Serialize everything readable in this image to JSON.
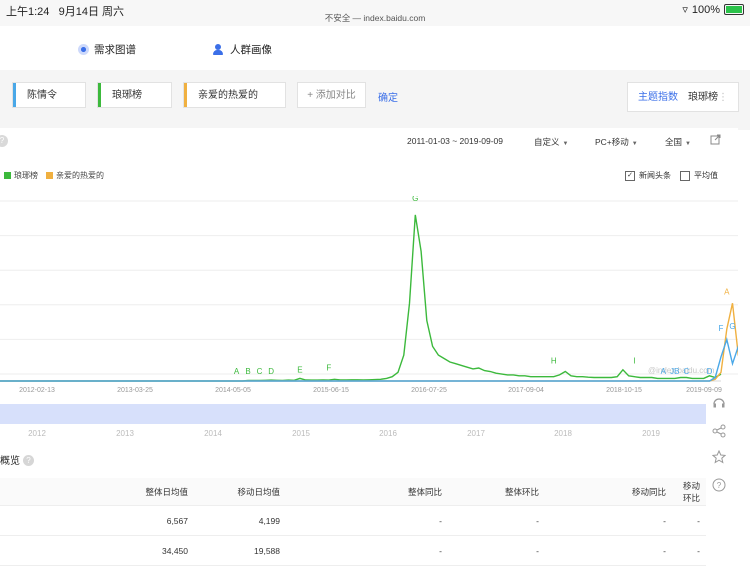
{
  "statusbar": {
    "time": "上午1:24",
    "date": "9月14日 周六",
    "url": "不安全 — index.baidu.com",
    "battery": "100%"
  },
  "subnav": {
    "tab1": "需求图谱",
    "tab2": "人群画像"
  },
  "keywords": {
    "items": [
      {
        "label": "陈情令",
        "color": "#4aa8e8"
      },
      {
        "label": "琅琊榜",
        "color": "#3cb93c"
      },
      {
        "label": "亲爱的热爱的",
        "color": "#f0b040"
      }
    ],
    "add_label": "+ 添加对比",
    "confirm_label": "确定",
    "theme_label": "主题指数",
    "theme_keyword": "琅琊榜"
  },
  "controls": {
    "date_range": "2011-01-03 ~ 2019-09-09",
    "custom": "自定义",
    "device": "PC+移动",
    "region": "全国"
  },
  "options": {
    "news": "新闻头条",
    "average": "平均值"
  },
  "chart_data": {
    "type": "line",
    "legend": [
      "琅琊榜",
      "亲爱的热爱的"
    ],
    "x_ticks": [
      "2012-02-13",
      "2013-03-25",
      "2014-05-05",
      "2015-06-15",
      "2016-07-25",
      "2017-09-04",
      "2018-10-15",
      "2019-09-09"
    ],
    "year_ticks": [
      "2012",
      "2013",
      "2014",
      "2015",
      "2016",
      "2017",
      "2018",
      "2019"
    ],
    "watermark": "@index.baidu.com",
    "series": [
      {
        "name": "琅琊榜",
        "color": "#3cb93c",
        "values": [
          0,
          0,
          0,
          0,
          0,
          0,
          0,
          0,
          0,
          0,
          0,
          0,
          0,
          0,
          0,
          0,
          0,
          0,
          0,
          0,
          0,
          0,
          0,
          0,
          0,
          0,
          0,
          0,
          0,
          0,
          0,
          0,
          0,
          0,
          0,
          0,
          0,
          0,
          0,
          0,
          0,
          0,
          0,
          0.3,
          0.3,
          0.3,
          0.4,
          0.5,
          0.4,
          0.3,
          0.5,
          0.4,
          1.5,
          0.6,
          0.5,
          0.5,
          0.6,
          0.5,
          1.0,
          0.6,
          0.6,
          0.7,
          0.7,
          0.6,
          0.7,
          0.8,
          1.0,
          1.5,
          2.5,
          5,
          15,
          45,
          96,
          75,
          35,
          20,
          15,
          13,
          11,
          10,
          9,
          8,
          7,
          7.5,
          6,
          5.5,
          4.5,
          4,
          3.5,
          3.5,
          3,
          3,
          2.5,
          2.5,
          2.5,
          2.5,
          2.5,
          3.5,
          5.5,
          3,
          2.5,
          2.5,
          2.2,
          2,
          2,
          2,
          2,
          2.5,
          6.5,
          3,
          2.5,
          2,
          2,
          2,
          1.5,
          1.5,
          1.5,
          1.5,
          2,
          2,
          1.5,
          1.5,
          1.5,
          3,
          2,
          4
        ]
      },
      {
        "name": "亲爱的热爱的",
        "color": "#f0b040",
        "values": [
          0,
          0,
          0,
          0,
          0,
          0,
          0,
          0,
          0,
          0,
          0,
          0,
          0,
          0,
          0,
          0,
          0,
          0,
          0,
          0,
          0,
          0,
          0,
          0,
          0,
          0,
          0,
          0,
          0,
          0,
          0,
          0,
          0,
          0,
          0,
          0,
          0,
          0,
          0,
          0,
          0,
          0,
          0,
          0,
          0,
          0,
          0,
          0,
          0,
          0,
          0,
          0,
          0,
          0,
          0,
          0,
          0,
          0,
          0,
          0,
          0,
          0,
          0,
          0,
          0,
          0,
          0,
          0,
          0,
          0,
          0,
          0,
          0,
          0,
          0,
          0,
          0,
          0,
          0,
          0,
          0,
          0,
          0,
          0,
          0,
          0,
          0,
          0,
          0,
          0,
          0,
          0,
          0,
          0,
          0,
          0,
          0,
          0,
          0,
          0,
          0,
          0,
          0,
          0,
          0,
          0,
          0,
          0,
          0,
          0,
          0,
          0,
          0,
          0,
          0,
          0,
          0,
          0,
          0,
          0,
          0,
          0,
          0,
          0,
          1,
          5,
          30,
          45,
          15,
          6
        ]
      },
      {
        "name": "陈情令",
        "color": "#4aa8e8",
        "values": [
          0,
          0,
          0,
          0,
          0,
          0,
          0,
          0,
          0,
          0,
          0,
          0,
          0,
          0,
          0,
          0,
          0,
          0,
          0,
          0,
          0,
          0,
          0,
          0,
          0,
          0,
          0,
          0,
          0,
          0,
          0,
          0,
          0,
          0,
          0,
          0,
          0,
          0,
          0,
          0,
          0,
          0,
          0,
          0,
          0,
          0,
          0,
          0,
          0,
          0,
          0,
          0,
          0,
          0,
          0,
          0,
          0,
          0,
          0,
          0,
          0,
          0,
          0,
          0,
          0,
          0,
          0,
          0,
          0,
          0,
          0,
          0,
          0,
          0,
          0,
          0,
          0,
          0,
          0,
          0,
          0,
          0,
          0,
          0,
          0,
          0,
          0,
          0,
          0,
          0,
          0,
          0,
          0,
          0,
          0,
          0,
          0,
          0,
          0,
          0,
          0,
          0,
          0,
          0,
          0,
          0,
          0,
          0,
          0,
          0,
          0,
          0,
          0,
          0,
          0,
          0,
          0,
          0,
          0,
          0,
          0,
          0,
          0,
          0,
          2,
          14,
          24,
          10,
          20,
          4
        ]
      }
    ],
    "annotations": [
      {
        "label": "A",
        "i": 41,
        "v": 4,
        "color": "#3cb93c"
      },
      {
        "label": "B",
        "i": 43,
        "v": 4,
        "color": "#3cb93c"
      },
      {
        "label": "C",
        "i": 45,
        "v": 4,
        "color": "#3cb93c"
      },
      {
        "label": "D",
        "i": 47,
        "v": 4,
        "color": "#3cb93c"
      },
      {
        "label": "E",
        "i": 52,
        "v": 5,
        "color": "#3cb93c"
      },
      {
        "label": "F",
        "i": 57,
        "v": 6,
        "color": "#3cb93c"
      },
      {
        "label": "G",
        "i": 72,
        "v": 104,
        "color": "#3cb93c"
      },
      {
        "label": "H",
        "i": 96,
        "v": 10,
        "color": "#3cb93c"
      },
      {
        "label": "I",
        "i": 110,
        "v": 10,
        "color": "#3cb93c"
      },
      {
        "label": "A",
        "i": 115,
        "v": 4,
        "color": "#4aa8e8"
      },
      {
        "label": "JB",
        "i": 117,
        "v": 4,
        "color": "#4aa8e8"
      },
      {
        "label": "C",
        "i": 119,
        "v": 4,
        "color": "#4aa8e8"
      },
      {
        "label": "D",
        "i": 123,
        "v": 4,
        "color": "#4aa8e8"
      },
      {
        "label": "A",
        "i": 126,
        "v": 50,
        "color": "#f0b040"
      },
      {
        "label": "F",
        "i": 125,
        "v": 29,
        "color": "#4aa8e8"
      },
      {
        "label": "G",
        "i": 127,
        "v": 30,
        "color": "#4aa8e8"
      }
    ]
  },
  "overview": {
    "title": "概览",
    "headers": [
      "整体日均值",
      "移动日均值",
      "整体同比",
      "整体环比",
      "移动同比",
      "移动环比"
    ],
    "rows": [
      [
        "6,567",
        "4,199",
        "-",
        "-",
        "-",
        "-"
      ],
      [
        "34,450",
        "19,588",
        "-",
        "-",
        "-",
        "-"
      ]
    ]
  }
}
